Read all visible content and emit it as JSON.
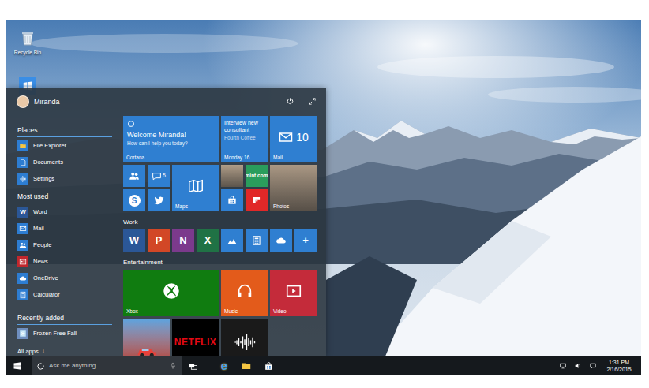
{
  "desktop": {
    "icons": [
      {
        "label": "Recycle Bin"
      }
    ]
  },
  "start_menu": {
    "user": {
      "name": "Miranda"
    },
    "sections": [
      {
        "header": "Places",
        "items": [
          {
            "label": "File Explorer",
            "kind": "folder",
            "color": "#2d7dd2"
          },
          {
            "label": "Documents",
            "kind": "document",
            "color": "#2d7dd2"
          },
          {
            "label": "Settings",
            "kind": "gear",
            "color": "#2d7dd2"
          }
        ]
      },
      {
        "header": "Most used",
        "items": [
          {
            "label": "Word",
            "kind": "glyph",
            "glyph": "W",
            "color": "#2b5797"
          },
          {
            "label": "Mail",
            "kind": "mail",
            "color": "#2d7dd2"
          },
          {
            "label": "People",
            "kind": "people",
            "color": "#2d7dd2"
          },
          {
            "label": "News",
            "kind": "news",
            "color": "#c1272d"
          },
          {
            "label": "OneDrive",
            "kind": "cloud",
            "color": "#2d7dd2"
          },
          {
            "label": "Calculator",
            "kind": "calculator",
            "color": "#2d7dd2"
          }
        ]
      },
      {
        "header": "Recently added",
        "items": [
          {
            "label": "Frozen Free Fall",
            "kind": "picture",
            "color": "#6f8fbf"
          }
        ]
      }
    ],
    "all_apps": {
      "label": "All apps",
      "icon": "↓"
    },
    "tile_groups": [
      {
        "tiles": [
          {
            "kind": "cortana",
            "title": "Welcome Miranda!",
            "subtitle": "How can I help you today?",
            "label": "Cortana",
            "color": "#2f7fd1"
          },
          {
            "kind": "calendar",
            "title": "Interview new consultant",
            "subtitle": "Fourth Coffee",
            "date": "Monday 16",
            "color": "#2f7fd1"
          },
          {
            "kind": "mail",
            "badge": "10",
            "label": "Mail",
            "color": "#2f7fd1"
          },
          {
            "kind": "people",
            "color": "#2f7fd1"
          },
          {
            "kind": "messaging",
            "badge": "5",
            "color": "#2f7fd1"
          },
          {
            "kind": "maps",
            "label": "Maps",
            "color": "#2f7fd1"
          },
          {
            "kind": "photo",
            "color": "#8c7d6c"
          },
          {
            "kind": "mint",
            "label": "mint.com",
            "color": "#2a9d5c"
          },
          {
            "kind": "photos",
            "label": "Photos",
            "color": "#7d6f61"
          },
          {
            "kind": "skype",
            "glyph": "S",
            "color": "#2f7fd1"
          },
          {
            "kind": "twitter",
            "color": "#2f7fd1"
          },
          {
            "kind": "store",
            "color": "#2f7fd1"
          },
          {
            "kind": "flipboard",
            "color": "#e12828"
          }
        ]
      },
      {
        "title": "Work",
        "tiles": [
          {
            "kind": "glyph",
            "glyph": "W",
            "color": "#2b5797"
          },
          {
            "kind": "glyph",
            "glyph": "P",
            "color": "#d24726"
          },
          {
            "kind": "glyph",
            "glyph": "N",
            "color": "#7b3a8c"
          },
          {
            "kind": "glyph",
            "glyph": "X",
            "color": "#207245"
          },
          {
            "kind": "money",
            "color": "#2f7fd1"
          },
          {
            "kind": "calculator",
            "color": "#2f7fd1"
          },
          {
            "kind": "cloud",
            "color": "#2f7fd1"
          },
          {
            "kind": "glyph",
            "glyph": "+",
            "color": "#2f7fd1"
          }
        ]
      },
      {
        "title": "Entertainment",
        "tiles": [
          {
            "kind": "xbox",
            "label": "Xbox",
            "color": "#107c10"
          },
          {
            "kind": "music",
            "label": "Music",
            "color": "#e35b1b"
          },
          {
            "kind": "video",
            "label": "Video",
            "color": "#c42b3a"
          },
          {
            "kind": "cars",
            "color": "#b7362a"
          },
          {
            "kind": "netflix",
            "label": "NETFLIX",
            "color": "#ffffff"
          },
          {
            "kind": "groove",
            "color": "#1a1a1a"
          }
        ]
      }
    ]
  },
  "taskbar": {
    "search": {
      "placeholder": "Ask me anything"
    },
    "apps": [
      {
        "kind": "task-view"
      },
      {
        "kind": "internet-explorer",
        "glyph": "e"
      },
      {
        "kind": "file-explorer"
      },
      {
        "kind": "store"
      }
    ],
    "clock": {
      "time": "1:31 PM",
      "date": "2/16/2015"
    }
  }
}
